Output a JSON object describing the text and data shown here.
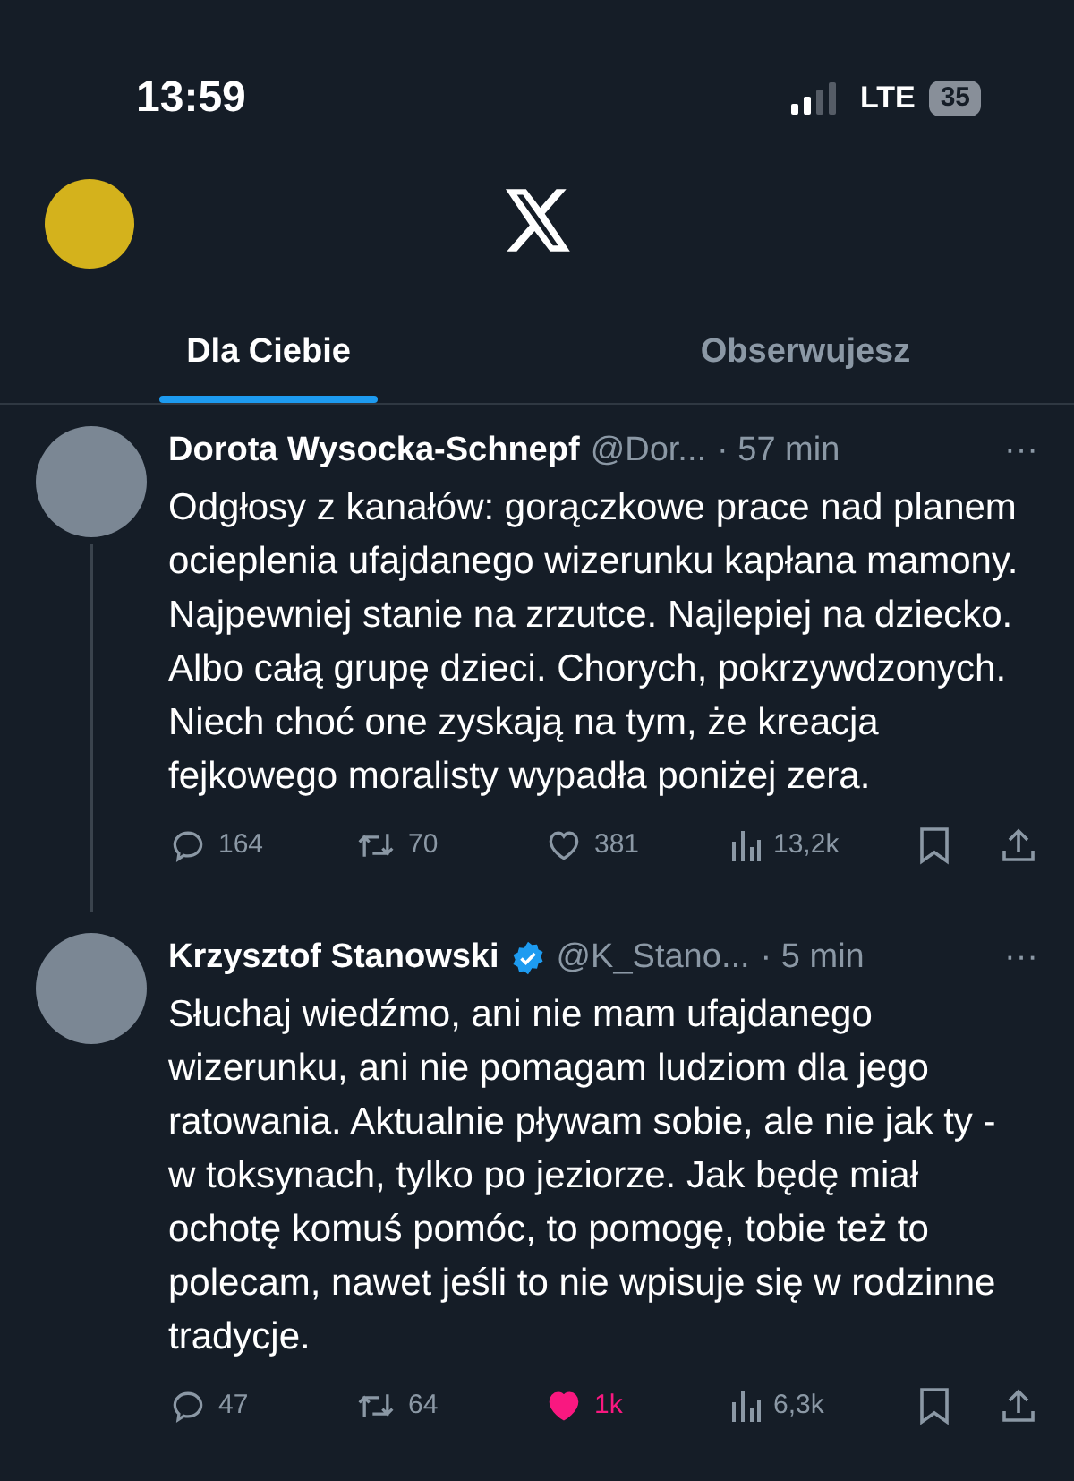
{
  "status_bar": {
    "time": "13:59",
    "network": "LTE",
    "battery": "35"
  },
  "tabs": [
    {
      "label": "Dla Ciebie",
      "selected": true
    },
    {
      "label": "Obserwujesz",
      "selected": false
    }
  ],
  "tweets": [
    {
      "name": "Dorota Wysocka-Schnepf",
      "verified": false,
      "handle": "@Dor...",
      "time": "· 57 min",
      "more": "···",
      "text": "Odgłosy z kanałów: gorączkowe prace nad planem ocieplenia ufajdanego wizerunku kapłana mamony. Najpewniej stanie na zrzutce. Najlepiej na dziecko. Albo całą grupę dzieci. Chorych, pokrzywdzonych. Niech choć one zyskają na tym, że kreacja fejkowego moralisty wypadła poniżej zera.",
      "thread_line": true,
      "replies": "164",
      "reposts": "70",
      "likes": "381",
      "liked": false,
      "views": "13,2k"
    },
    {
      "name": "Krzysztof Stanowski",
      "verified": true,
      "handle": "@K_Stano...",
      "time": "· 5 min",
      "more": "···",
      "text": "Słuchaj wiedźmo, ani nie mam ufajdanego wizerunku, ani nie pomagam ludziom dla jego ratowania. Aktualnie pływam sobie, ale nie jak ty - w toksynach, tylko po jeziorze. Jak będę miał ochotę komuś pomóc, to pomogę, tobie też to polecam, nawet jeśli to nie wpisuje się w rodzinne tradycje.",
      "thread_line": false,
      "replies": "47",
      "reposts": "64",
      "likes": "1k",
      "liked": true,
      "views": "6,3k"
    }
  ]
}
